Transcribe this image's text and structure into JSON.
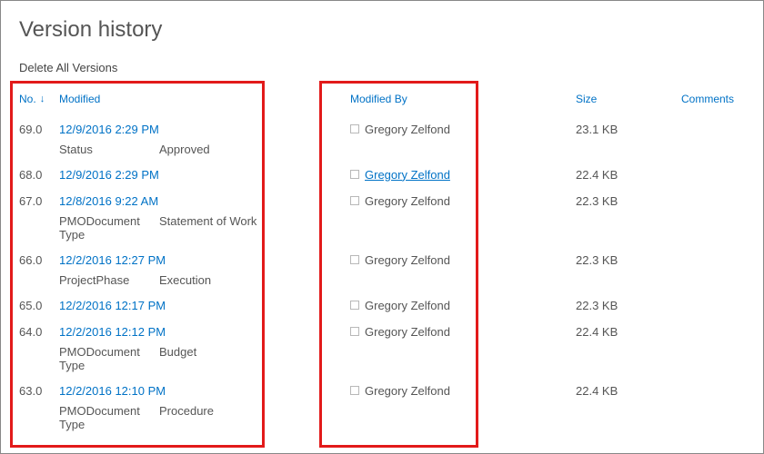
{
  "title": "Version history",
  "delete_all_label": "Delete All Versions",
  "headers": {
    "no": "No.",
    "modified": "Modified",
    "modified_by": "Modified By",
    "size": "Size",
    "comments": "Comments"
  },
  "sort_icon": "↓",
  "versions": [
    {
      "no": "69.0",
      "modified": "12/9/2016 2:29 PM",
      "by": "Gregory Zelfond",
      "by_linked": false,
      "size": "23.1 KB",
      "meta": [
        {
          "label": "Status",
          "value": "Approved"
        }
      ]
    },
    {
      "no": "68.0",
      "modified": "12/9/2016 2:29 PM",
      "by": "Gregory Zelfond",
      "by_linked": true,
      "size": "22.4 KB",
      "meta": []
    },
    {
      "no": "67.0",
      "modified": "12/8/2016 9:22 AM",
      "by": "Gregory Zelfond",
      "by_linked": false,
      "size": "22.3 KB",
      "meta": [
        {
          "label": "PMODocument Type",
          "value": "Statement of Work"
        }
      ]
    },
    {
      "no": "66.0",
      "modified": "12/2/2016 12:27 PM",
      "by": "Gregory Zelfond",
      "by_linked": false,
      "size": "22.3 KB",
      "meta": [
        {
          "label": "ProjectPhase",
          "value": "Execution"
        }
      ]
    },
    {
      "no": "65.0",
      "modified": "12/2/2016 12:17 PM",
      "by": "Gregory Zelfond",
      "by_linked": false,
      "size": "22.3 KB",
      "meta": []
    },
    {
      "no": "64.0",
      "modified": "12/2/2016 12:12 PM",
      "by": "Gregory Zelfond",
      "by_linked": false,
      "size": "22.4 KB",
      "meta": [
        {
          "label": "PMODocument Type",
          "value": "Budget"
        }
      ]
    },
    {
      "no": "63.0",
      "modified": "12/2/2016 12:10 PM",
      "by": "Gregory Zelfond",
      "by_linked": false,
      "size": "22.4 KB",
      "meta": [
        {
          "label": "PMODocument Type",
          "value": "Procedure"
        }
      ]
    }
  ]
}
